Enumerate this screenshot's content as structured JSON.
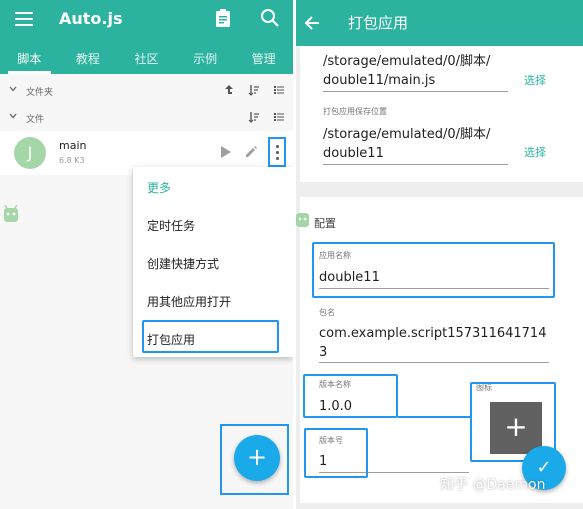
{
  "left": {
    "app_title": "Auto.js",
    "tabs": [
      "脚本",
      "教程",
      "社区",
      "示例",
      "管理"
    ],
    "sections": [
      {
        "label": "文件夹"
      },
      {
        "label": "文件"
      }
    ],
    "file": {
      "avatar_letter": "J",
      "name": "main",
      "size": "6.8 K3"
    },
    "menu": {
      "header": "更多",
      "items": [
        "定时任务",
        "创建快捷方式",
        "用其他应用打开",
        "打包应用"
      ]
    },
    "fab_label": "+"
  },
  "right": {
    "title": "打包应用",
    "source_path": [
      "/storage/emulated/0/脚本/",
      "double11/main.js"
    ],
    "source_select": "选择",
    "save_label": "打包应用保存位置",
    "save_path": [
      "/storage/emulated/0/脚本/",
      "double11"
    ],
    "save_select": "选择",
    "config_title": "配置",
    "app_name_label": "应用名称",
    "app_name_value": "double11",
    "package_label": "包名",
    "package_value": [
      "com.example.script157311641714",
      "3"
    ],
    "version_name_label": "版本名称",
    "version_name_value": "1.0.0",
    "icon_label": "图标",
    "icon_add": "+",
    "version_code_label": "版本号",
    "version_code_value": "1",
    "confirm_icon": "✓",
    "watermark": "知乎 @Daemon"
  },
  "colors": {
    "primary": "#2bb39f",
    "accent": "#1aa9e9",
    "highlight": "#2196f3"
  },
  "icons": [
    "menu-icon",
    "clipboard-icon",
    "search-icon",
    "back-arrow-icon",
    "play-icon",
    "edit-icon",
    "more-vert-icon",
    "sort-icon",
    "list-icon",
    "upload-icon",
    "chevron-down-icon",
    "add-icon",
    "check-icon"
  ]
}
